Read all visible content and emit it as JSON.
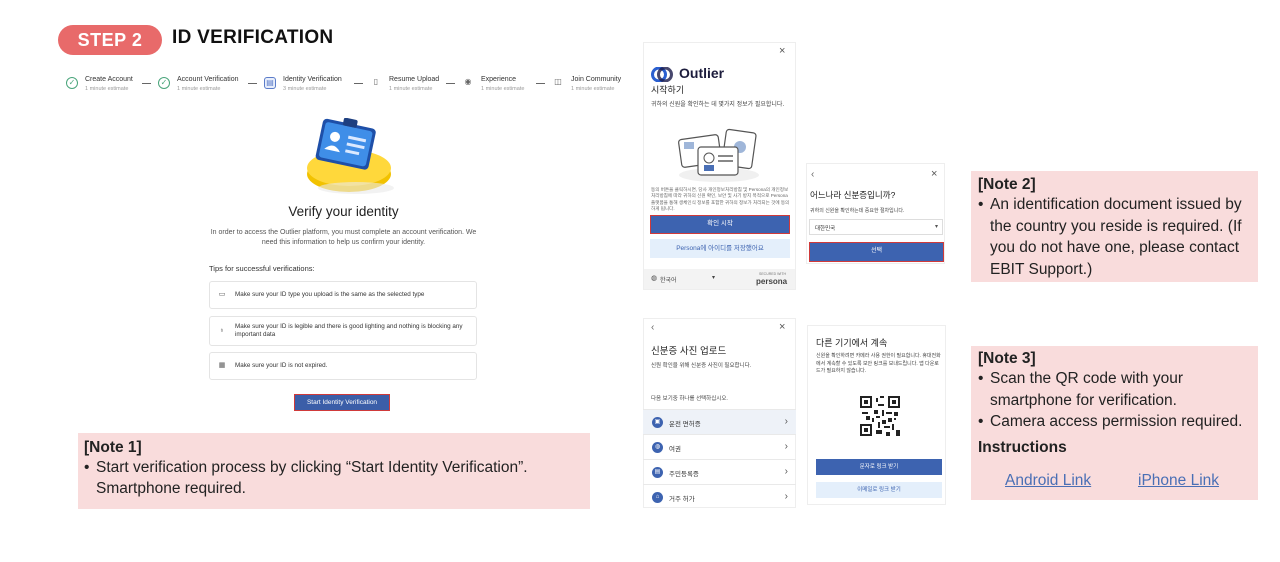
{
  "header": {
    "step_label": "STEP 2",
    "title": "ID VERIFICATION"
  },
  "progress": [
    {
      "label": "Create Account",
      "sub": "1 minute estimate",
      "state": "done"
    },
    {
      "label": "Account Verification",
      "sub": "1 minute estimate",
      "state": "done"
    },
    {
      "label": "Identity Verification",
      "sub": "3 minute estimate",
      "state": "current"
    },
    {
      "label": "Resume Upload",
      "sub": "1 minute estimate",
      "state": "todo"
    },
    {
      "label": "Experience",
      "sub": "1 minute estimate",
      "state": "todo"
    },
    {
      "label": "Join Community",
      "sub": "1 minute estimate",
      "state": "todo"
    }
  ],
  "verify": {
    "heading": "Verify your identity",
    "description": "In order to access the Outlier platform, you must complete an account verification. We need this information to help us confirm your identity.",
    "tips_heading": "Tips for successful verifications:",
    "tips": [
      "Make sure your ID type you upload is the same as the selected type",
      "Make sure your ID is legible and there is good lighting and nothing is blocking any important data",
      "Make sure your ID is not expired."
    ],
    "start_button": "Start Identity Verification"
  },
  "note1": {
    "title": "[Note 1]",
    "bullet": "•",
    "line1": "Start verification process by clicking “Start Identity Verification”.",
    "line2": "Smartphone required."
  },
  "panel_start": {
    "brand": "Outlier",
    "heading": "시작하기",
    "intro": "귀하의 신원을 확인하는 데 몇가지 정보가 필요합니다.",
    "fine_print": "동의 버튼을 클릭하시면, 당사 개인정보처리방침 및 Persona의 개인정보처리방침에 따라 귀하의 신원 확인, 보안 및 사기 방지 목적으로 Persona 플랫폼을 통해 생체인식 정보를 포함한 귀하의 정보가 처리되는 것에 동의하게 됩니다.",
    "confirm_button": "확인 시작",
    "save_button": "Persona에 아이디를 저장했어요",
    "language": "한국어",
    "secured": "SECURED WITH",
    "persona": "persona"
  },
  "panel_country": {
    "heading": "어느나라 신분증입니까?",
    "subtext": "귀하의 신원을 확인하는데 중요한 절차입니다.",
    "selected": "대한민국",
    "select_button": "선택"
  },
  "note2": {
    "title": "[Note 2]",
    "bullet": "•",
    "text": "An identification document issued by the country you reside is required. (If you do not have one, please contact EBIT Support.)"
  },
  "panel_upload": {
    "heading": "신분증 사진 업로드",
    "subtext": "신원 확인을 위해 신분증 사진이 필요합니다.",
    "choose": "다음 보기중 하나를 선택하십시오.",
    "options": [
      "운전 면허증",
      "여권",
      "주민등록증",
      "거주 허가"
    ]
  },
  "panel_device": {
    "heading": "다른 기기에서 계속",
    "subtext": "신원을 확인하려면 카메라 사용 권한이 필요합니다. 휴대전화에서 계속할 수 있도록 보안 링크를 보내드립니다. 앱 다운로드가 필요하지 않습니다.",
    "sms_button": "문자로 링크 받기",
    "email_button": "이메일로 링크 받기"
  },
  "note3": {
    "title": "[Note 3]",
    "bullet": "•",
    "b1": "Scan the QR code with your smartphone for  verification.",
    "b2": "Camera access permission required.",
    "instructions": "Instructions",
    "android": "Android Link",
    "iphone": "iPhone Link"
  },
  "colors": {
    "accent": "#e86a6a",
    "note_bg": "#f9dcdc",
    "button_blue": "#3b5ea8",
    "link": "#4a6fb5"
  }
}
